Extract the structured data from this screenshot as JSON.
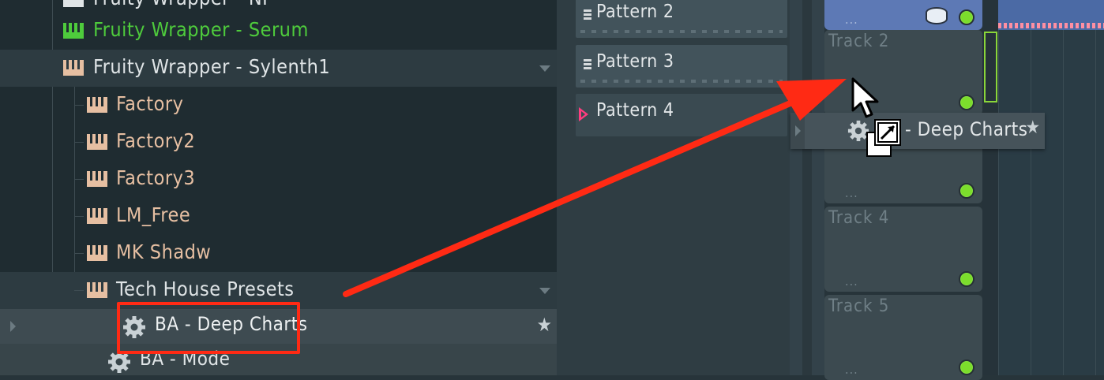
{
  "browser": {
    "items": [
      {
        "label": "Fruity Wrapper - NI",
        "kind": "plugin"
      },
      {
        "label": "Fruity Wrapper - Serum",
        "kind": "plugin-green"
      },
      {
        "label": "Fruity Wrapper - Sylenth1",
        "kind": "plugin-open"
      },
      {
        "label": "Factory",
        "kind": "folder"
      },
      {
        "label": "Factory2",
        "kind": "folder"
      },
      {
        "label": "Factory3",
        "kind": "folder"
      },
      {
        "label": "LM_Free",
        "kind": "folder"
      },
      {
        "label": "MK Shadw",
        "kind": "folder"
      },
      {
        "label": "Tech House Presets",
        "kind": "folder-open"
      },
      {
        "label": "BA - Deep Charts",
        "kind": "preset-selected"
      },
      {
        "label": "BA - Mode",
        "kind": "preset"
      }
    ],
    "star": "★"
  },
  "patterns": {
    "items": [
      {
        "label": "Pattern 2"
      },
      {
        "label": "Pattern 3"
      },
      {
        "label": "Pattern 4"
      }
    ]
  },
  "playlist": {
    "tracks": [
      {
        "label": "",
        "dots": "..."
      },
      {
        "label": "Track 2",
        "dots": "..."
      },
      {
        "label": "",
        "dots": "..."
      },
      {
        "label": "Track 4",
        "dots": "..."
      },
      {
        "label": "Track 5",
        "dots": "..."
      }
    ]
  },
  "drag_preview": {
    "label": "- Deep Charts",
    "star": "★"
  },
  "colors": {
    "annotation": "#ff2a14",
    "accent_green": "#4ecb3c",
    "led": "#7cdd2c"
  }
}
